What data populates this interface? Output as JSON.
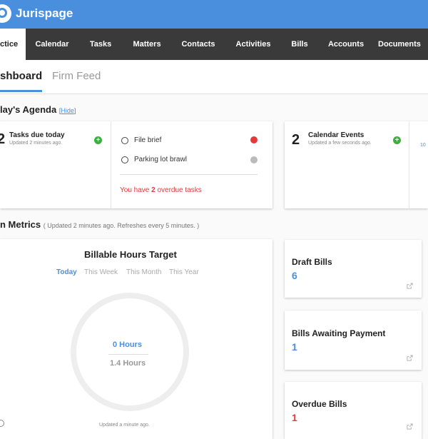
{
  "app": {
    "name": "Jurispage",
    "brand_color": "#4a8fde"
  },
  "nav": {
    "items": [
      {
        "label": "ctice",
        "active": true
      },
      {
        "label": "Calendar"
      },
      {
        "label": "Tasks"
      },
      {
        "label": "Matters"
      },
      {
        "label": "Contacts"
      },
      {
        "label": "Activities"
      },
      {
        "label": "Bills"
      },
      {
        "label": "Accounts"
      },
      {
        "label": "Documents"
      }
    ]
  },
  "tabs": [
    {
      "label": "shboard",
      "active": true
    },
    {
      "label": "Firm Feed"
    }
  ],
  "agenda": {
    "title": "lay's Agenda",
    "hide_label": "Hide",
    "tasks": {
      "count": "2",
      "title": "Tasks due today",
      "updated": "Updated 2 minutes ago.",
      "items": [
        {
          "label": "File brief",
          "status_color": "#e03a3a"
        },
        {
          "label": "Parking lot brawl",
          "status_color": "#bbbbbb"
        }
      ],
      "overdue_prefix": "You have ",
      "overdue_count": "2",
      "overdue_suffix": " overdue tasks"
    },
    "calendar": {
      "count": "2",
      "title": "Calendar Events",
      "updated": "Updated a few seconds ago."
    },
    "peek": {
      "text": "10"
    }
  },
  "metrics": {
    "title": "n Metrics",
    "note": "( Updated 2 minutes ago. Refreshes every 5 minutes. )",
    "billable": {
      "title": "Billable Hours Target",
      "periods": [
        "Today",
        "This Week",
        "This Month",
        "This Year"
      ],
      "active_period": "Today",
      "current": "0 Hours",
      "target": "1.4 Hours",
      "updated": "Updated a minute ago."
    }
  },
  "bills": [
    {
      "title": "Draft Bills",
      "value": "6",
      "color": "blue"
    },
    {
      "title": "Bills Awaiting Payment",
      "value": "1",
      "color": "blue"
    },
    {
      "title": "Overdue Bills",
      "value": "1",
      "color": "red"
    }
  ]
}
